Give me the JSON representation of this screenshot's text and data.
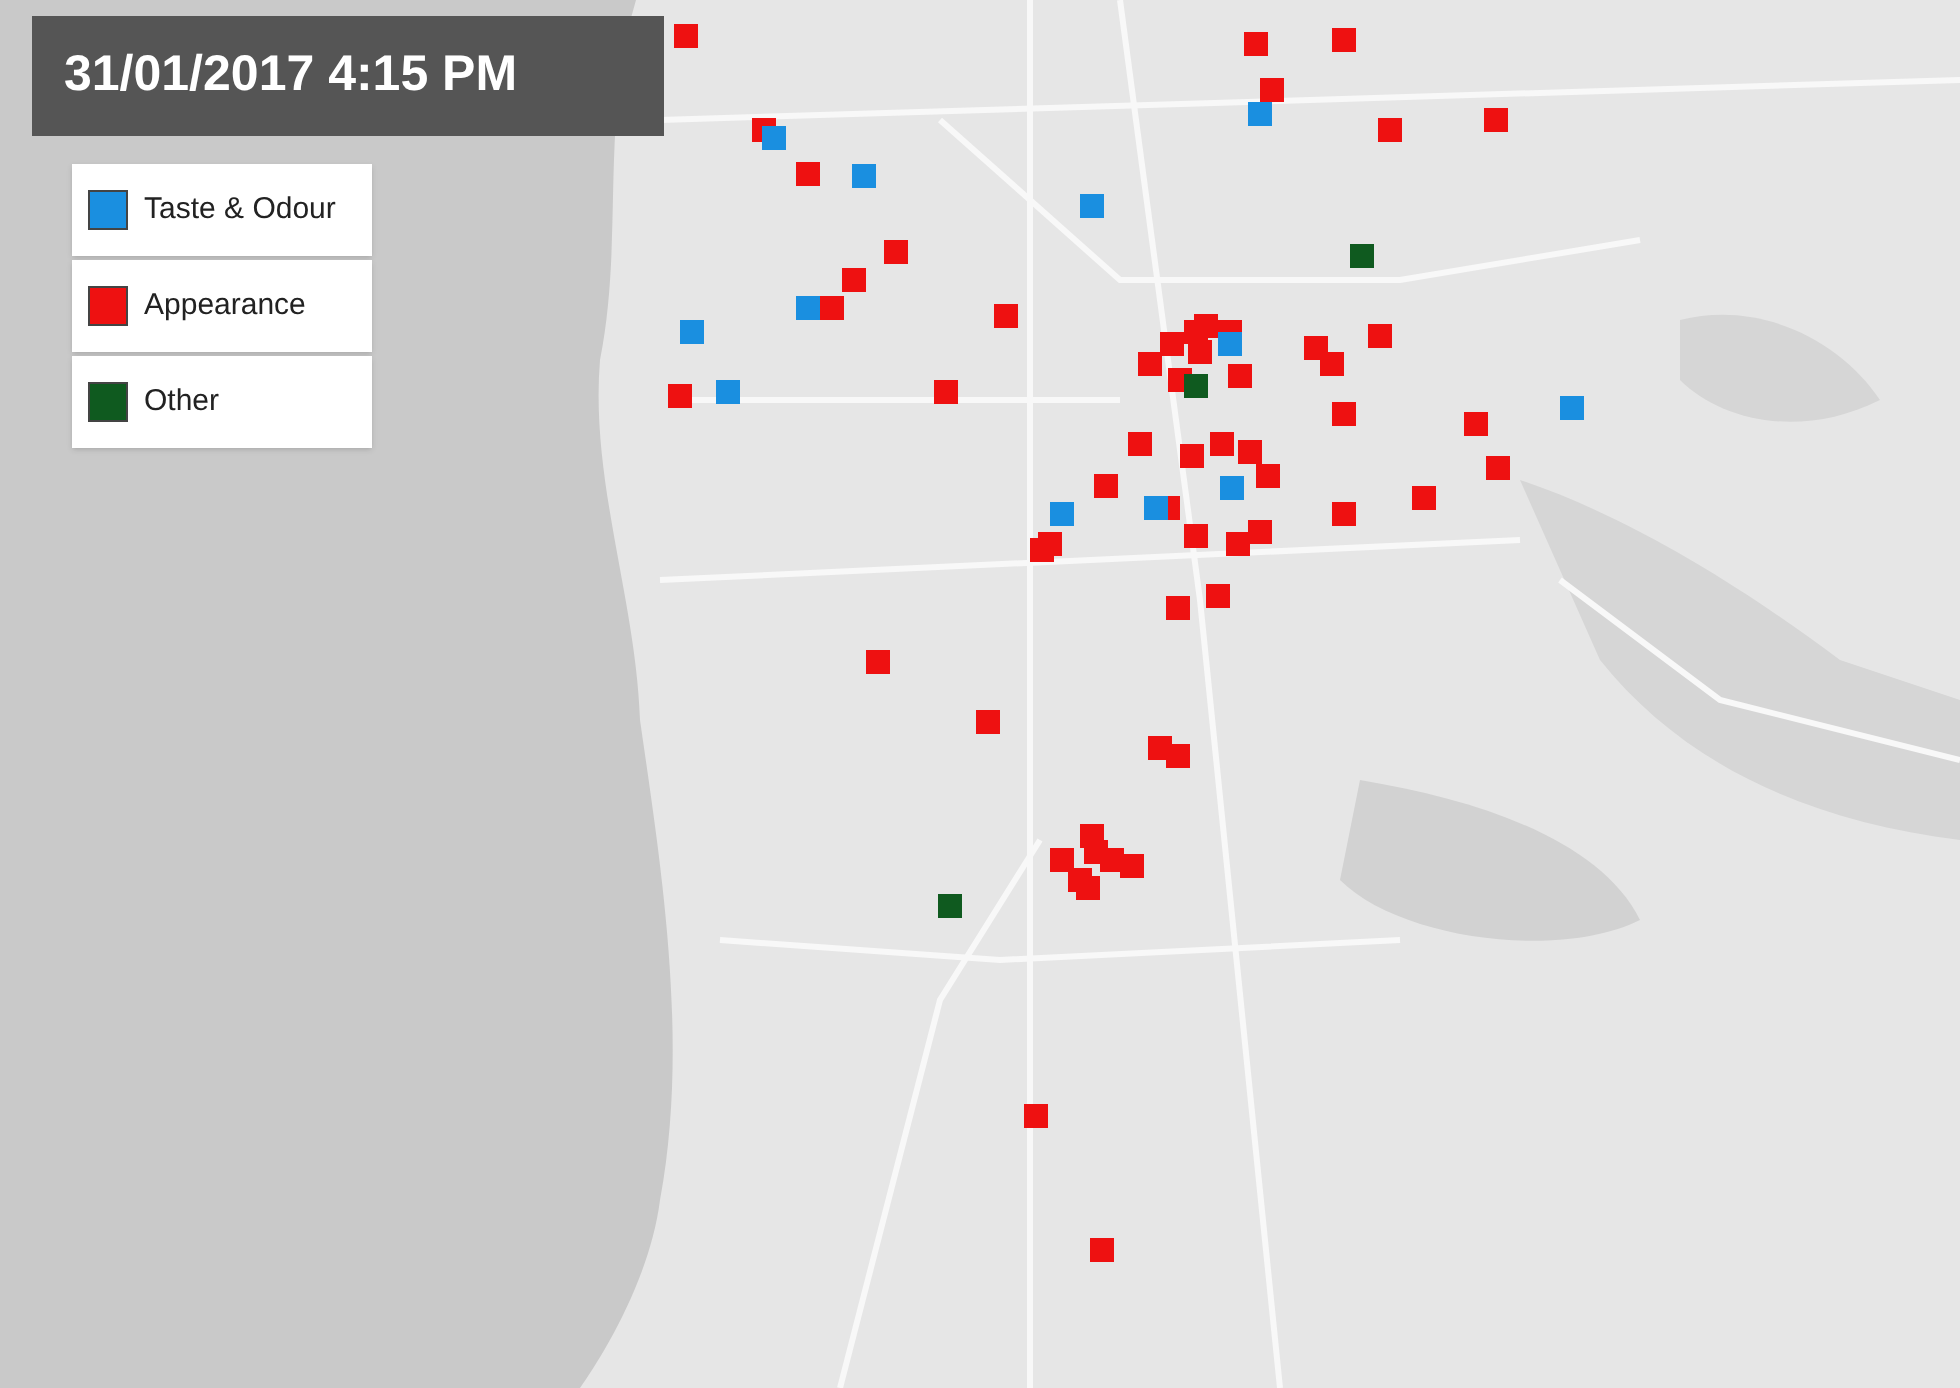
{
  "title": "31/01/2017 4:15 PM",
  "legend": [
    {
      "label": "Taste & Odour",
      "color": "#1a8fe0"
    },
    {
      "label": "Appearance",
      "color": "#ee1111"
    },
    {
      "label": "Other",
      "color": "#0f5a1f"
    }
  ]
}
